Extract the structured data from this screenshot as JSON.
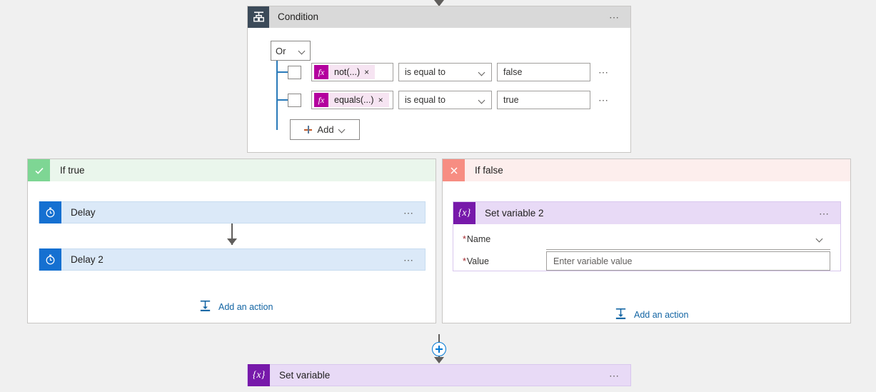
{
  "condition": {
    "icon": "condition-icon",
    "title": "Condition",
    "menu": "⋯",
    "group_operator": "Or",
    "rows": [
      {
        "token": "not(...)",
        "token_icon": "fx",
        "remove": "×",
        "operator": "is equal to",
        "value": "false",
        "menu": "⋯"
      },
      {
        "token": "equals(...)",
        "token_icon": "fx",
        "remove": "×",
        "operator": "is equal to",
        "value": "true",
        "menu": "⋯"
      }
    ],
    "add_label": "Add"
  },
  "branch_true": {
    "badge_icon": "check-icon",
    "title": "If true",
    "actions": [
      {
        "icon": "clock-icon",
        "title": "Delay",
        "menu": "⋯"
      },
      {
        "icon": "clock-icon",
        "title": "Delay 2",
        "menu": "⋯"
      }
    ],
    "add_action_label": "Add an action"
  },
  "branch_false": {
    "badge_icon": "close-icon",
    "title": "If false",
    "card": {
      "icon": "variable-icon",
      "icon_glyph": "{x}",
      "title": "Set variable 2",
      "menu": "⋯",
      "fields": [
        {
          "label": "Name",
          "required": "*",
          "value": "",
          "type": "combobox"
        },
        {
          "label": "Value",
          "required": "*",
          "placeholder": "Enter variable value",
          "type": "text"
        }
      ]
    },
    "add_action_label": "Add an action"
  },
  "bottom_card": {
    "icon": "variable-icon",
    "icon_glyph": "{x}",
    "title": "Set variable",
    "menu": "⋯"
  },
  "colors": {
    "canvas": "#f0f0f0",
    "condition_header": "#d9d9d9",
    "condition_icon": "#3b4a59",
    "true_header": "#eaf6ec",
    "true_badge": "#7ed694",
    "false_header": "#fdeeed",
    "false_badge": "#f78d82",
    "delay_card": "#dbe9f8",
    "delay_icon": "#1570d1",
    "variable_card": "#e8daf6",
    "variable_icon": "#7719aa",
    "token_accent": "#b4009e",
    "link_blue": "#1264a3",
    "required_red": "#a4262c",
    "tree_line": "#2a7ab9"
  }
}
